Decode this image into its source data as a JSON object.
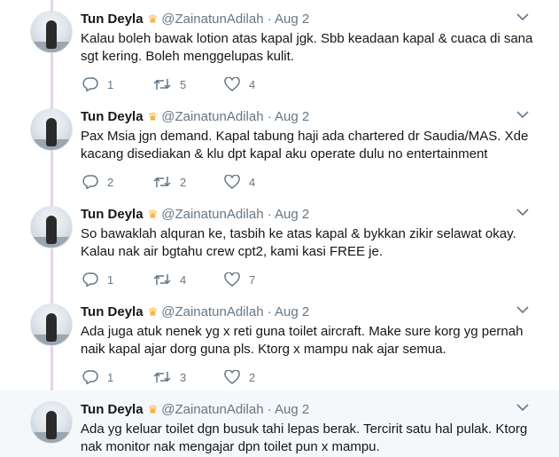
{
  "accent_colors": {
    "thread_line": "#e6d3e8",
    "secondary_text": "#657786",
    "highlight_bg": "#f5f8fa"
  },
  "tweets": [
    {
      "name": "Tun Deyla",
      "badge_icon": "crown-emoji",
      "handle": "@ZainatunAdilah",
      "date": "· Aug 2",
      "text": "Kalau boleh bawak lotion atas kapal jgk. Sbb keadaan kapal & cuaca di sana sgt kering. Boleh menggelupas kulit.",
      "replies": "1",
      "retweets": "5",
      "likes": "4"
    },
    {
      "name": "Tun Deyla",
      "badge_icon": "crown-emoji",
      "handle": "@ZainatunAdilah",
      "date": "· Aug 2",
      "text": "Pax Msia jgn demand. Kapal tabung haji ada chartered dr Saudia/MAS. Xde kacang disediakan & klu dpt kapal aku operate dulu no entertainment",
      "replies": "2",
      "retweets": "2",
      "likes": "4"
    },
    {
      "name": "Tun Deyla",
      "badge_icon": "crown-emoji",
      "handle": "@ZainatunAdilah",
      "date": "· Aug 2",
      "text": "So bawaklah alquran ke, tasbih ke atas kapal & bykkan zikir selawat okay. Kalau nak air bgtahu crew cpt2, kami kasi FREE je.",
      "replies": "1",
      "retweets": "4",
      "likes": "7"
    },
    {
      "name": "Tun Deyla",
      "badge_icon": "crown-emoji",
      "handle": "@ZainatunAdilah",
      "date": "· Aug 2",
      "text": "Ada juga atuk nenek yg x reti guna toilet aircraft. Make sure korg yg pernah naik kapal ajar dorg guna pls. Ktorg x mampu nak ajar semua.",
      "replies": "1",
      "retweets": "3",
      "likes": "2"
    },
    {
      "name": "Tun Deyla",
      "badge_icon": "crown-emoji",
      "handle": "@ZainatunAdilah",
      "date": "· Aug 2",
      "text": "Ada yg keluar toilet dgn busuk tahi lepas berak. Tercirit satu hal pulak. Ktorg nak monitor nak mengajar dpn toilet pun x mampu."
    }
  ]
}
